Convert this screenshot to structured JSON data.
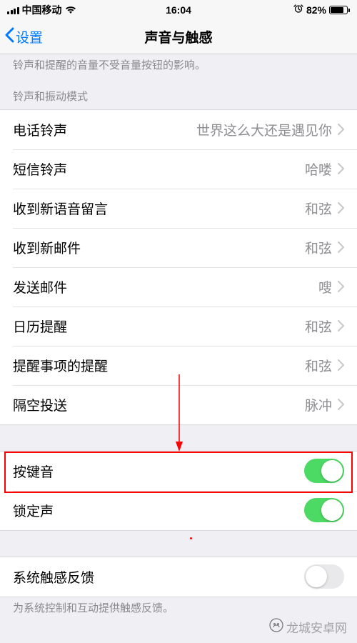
{
  "status": {
    "carrier": "中国移动",
    "time": "16:04",
    "battery_pct": "82%"
  },
  "nav": {
    "back_label": "设置",
    "title": "声音与触感"
  },
  "top_note": "铃声和提醒的音量不受音量按钮的影响。",
  "section1_header": "铃声和振动模式",
  "rows": {
    "ringtone": {
      "label": "电话铃声",
      "value": "世界这么大还是遇见你"
    },
    "text_tone": {
      "label": "短信铃声",
      "value": "哈喽"
    },
    "voicemail": {
      "label": "收到新语音留言",
      "value": "和弦"
    },
    "new_mail": {
      "label": "收到新邮件",
      "value": "和弦"
    },
    "sent_mail": {
      "label": "发送邮件",
      "value": "嗖"
    },
    "calendar": {
      "label": "日历提醒",
      "value": "和弦"
    },
    "reminders": {
      "label": "提醒事项的提醒",
      "value": "和弦"
    },
    "airdrop": {
      "label": "隔空投送",
      "value": "脉冲"
    }
  },
  "toggles": {
    "keyclicks": {
      "label": "按键音",
      "on": true
    },
    "lock_sound": {
      "label": "锁定声",
      "on": true
    }
  },
  "haptics": {
    "label": "系统触感反馈",
    "on": false,
    "note": "为系统控制和互动提供触感反馈。"
  },
  "watermark": "龙城安卓网"
}
